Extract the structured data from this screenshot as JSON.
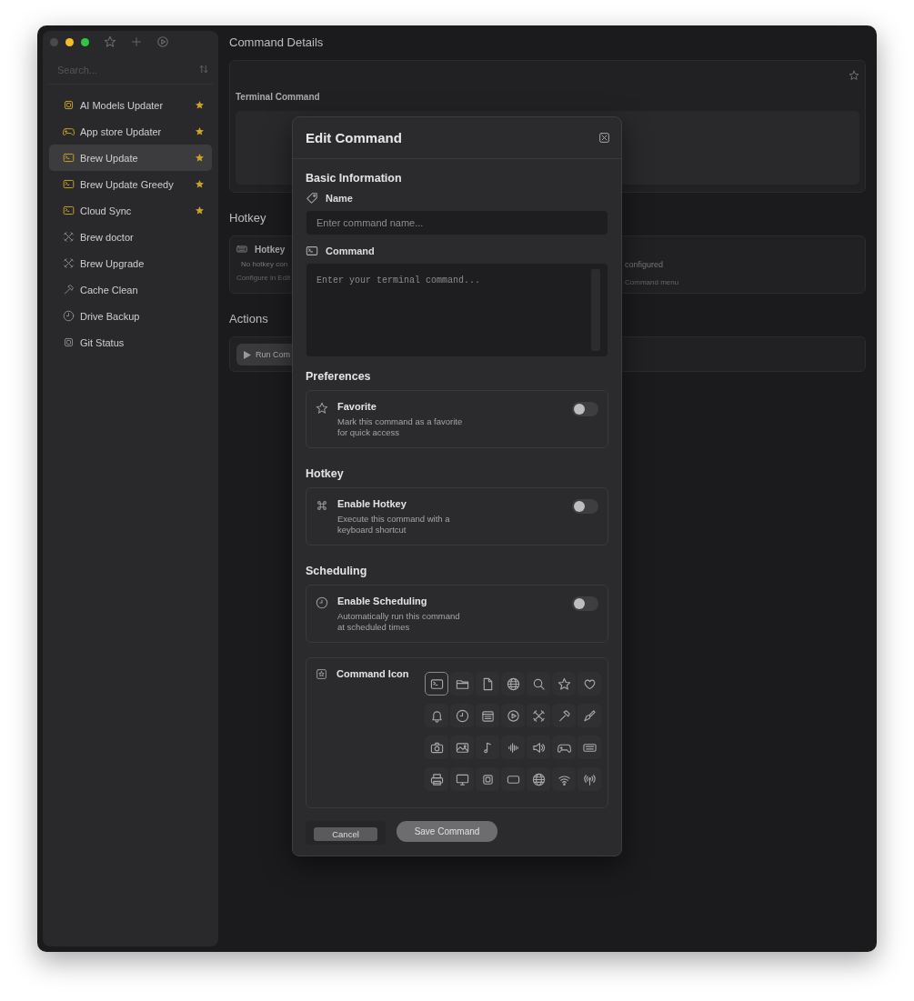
{
  "sidebar": {
    "search": {
      "placeholder": "Search..."
    },
    "items": [
      {
        "label": "AI Models Updater",
        "favorite": true,
        "selected": false
      },
      {
        "label": "App store Updater",
        "favorite": true,
        "selected": false
      },
      {
        "label": "Brew Update",
        "favorite": true,
        "selected": true
      },
      {
        "label": "Brew Update Greedy",
        "favorite": true,
        "selected": false
      },
      {
        "label": "Cloud Sync",
        "favorite": true,
        "selected": false
      },
      {
        "label": "Brew doctor",
        "favorite": false,
        "selected": false
      },
      {
        "label": "Brew Upgrade",
        "favorite": false,
        "selected": false
      },
      {
        "label": "Cache Clean",
        "favorite": false,
        "selected": false
      },
      {
        "label": "Drive Backup",
        "favorite": false,
        "selected": false
      },
      {
        "label": "Git Status",
        "favorite": false,
        "selected": false
      }
    ]
  },
  "main": {
    "title": "Command Details",
    "details_card": {
      "label": "Terminal Command"
    },
    "hotkey": {
      "heading": "Hotkey",
      "title": "Hotkey",
      "text": "No hotkey con",
      "hint": "Configure in Edit"
    },
    "scheduling": {
      "text": "configured",
      "hint": "Command menu"
    },
    "actions": {
      "heading": "Actions",
      "buttons": [
        "Run Com"
      ]
    }
  },
  "dialog": {
    "title": "Edit Command",
    "basic": {
      "heading": "Basic Information",
      "name_field": {
        "label": "Name",
        "placeholder": "Enter command name..."
      },
      "command_field": {
        "label": "Command",
        "placeholder": "Enter your terminal command..."
      }
    },
    "options": [
      {
        "heading": "Preferences",
        "title": "Favorite",
        "description": "Mark this command as a favorite for quick access",
        "on": false
      },
      {
        "heading": "Hotkey",
        "title": "Enable Hotkey",
        "description": "Execute this command with a keyboard shortcut",
        "on": false
      },
      {
        "heading": "Scheduling",
        "title": "Enable Scheduling",
        "description": "Automatically run this command at scheduled times",
        "on": false
      }
    ],
    "icon_picker": {
      "label": "Command Icon",
      "options": [
        {
          "selected": true
        },
        {
          "selected": false
        },
        {
          "selected": false
        },
        {
          "selected": false
        },
        {
          "selected": false
        },
        {
          "selected": false
        },
        {
          "selected": false
        },
        {
          "selected": false
        },
        {
          "selected": false
        },
        {
          "selected": false
        },
        {
          "selected": false
        },
        {
          "selected": false
        },
        {
          "selected": false
        },
        {
          "selected": false
        },
        {
          "selected": false
        },
        {
          "selected": false
        },
        {
          "selected": false
        },
        {
          "selected": false
        },
        {
          "selected": false
        },
        {
          "selected": false
        },
        {
          "selected": false
        },
        {
          "selected": false
        },
        {
          "selected": false
        },
        {
          "selected": false
        },
        {
          "selected": false
        },
        {
          "selected": false
        },
        {
          "selected": false
        },
        {
          "selected": false
        }
      ]
    },
    "buttons": {
      "cancel": "Cancel",
      "save": "Save Command"
    }
  }
}
